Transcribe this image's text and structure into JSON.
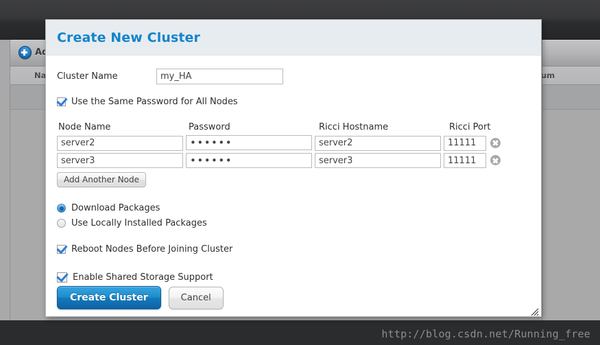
{
  "background": {
    "toolbar": {
      "add_label": "Add",
      "add_icon": "plus-circle-icon"
    },
    "table_headers": {
      "name": "Nam",
      "quorum": "um"
    },
    "watermark": "http://blog.csdn.net/Running_free"
  },
  "dialog": {
    "title": "Create New Cluster",
    "cluster_name": {
      "label": "Cluster Name",
      "value": "my_HA",
      "placeholder": ""
    },
    "same_password": {
      "label": "Use the Same Password for All Nodes",
      "checked": true
    },
    "node_table": {
      "columns": [
        "Node Name",
        "Password",
        "Ricci Hostname",
        "Ricci Port"
      ],
      "rows": [
        {
          "node_name": "server2",
          "password": "••••••",
          "ricci_hostname": "server2",
          "ricci_port": "11111",
          "delete_icon": "remove-circle-icon"
        },
        {
          "node_name": "server3",
          "password": "••••••",
          "ricci_hostname": "server3",
          "ricci_port": "11111",
          "delete_icon": "remove-circle-icon"
        }
      ],
      "add_node_label": "Add Another Node"
    },
    "package_options": {
      "selected": "download",
      "items": [
        {
          "id": "download",
          "label": "Download Packages",
          "selected": true
        },
        {
          "id": "local",
          "label": "Use Locally Installed Packages",
          "selected": false
        }
      ]
    },
    "reboot_nodes": {
      "label": "Reboot Nodes Before Joining Cluster",
      "checked": true
    },
    "shared_storage": {
      "label": "Enable Shared Storage Support",
      "checked": true
    },
    "footer": {
      "create_label": "Create Cluster",
      "cancel_label": "Cancel",
      "resize_icon": "resize-grip-icon"
    }
  },
  "colors": {
    "accent_blue": "#1484cb",
    "primary_button": "#1279bc",
    "page_background": "#a9a9aa",
    "dark_bar": "#2b2c2e",
    "header_background": "#e7ecf0"
  }
}
